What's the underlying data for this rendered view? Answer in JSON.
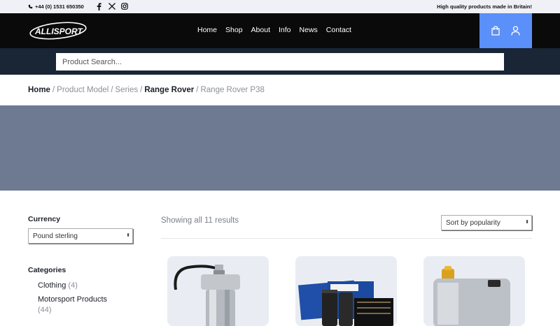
{
  "topbar": {
    "phone": "+44 (0) 1531 650350",
    "socials": [
      "facebook-icon",
      "x-icon",
      "instagram-icon"
    ],
    "tagline": "High quality products made in Britain!"
  },
  "header": {
    "logo_text": "ALLISPORT",
    "nav": [
      "Home",
      "Shop",
      "About",
      "Info",
      "News",
      "Contact"
    ],
    "accent": "#5b8ff9"
  },
  "search": {
    "placeholder": "Product Search..."
  },
  "breadcrumb": {
    "home": "Home",
    "product_model": "Product Model",
    "series": "Series",
    "range_rover": "Range Rover",
    "current": "Range Rover P38",
    "sep": "/"
  },
  "sidebar": {
    "currency_heading": "Currency",
    "currency_value": "Pound sterling",
    "categories_heading": "Categories",
    "categories": [
      {
        "label": "Clothing",
        "count": "(4)"
      },
      {
        "label": "Motorsport Products",
        "count": "(44)"
      }
    ]
  },
  "shop": {
    "results_text": "Showing all 11 results",
    "sort_value": "Sort by popularity"
  },
  "products": [
    {
      "name": "product-filter-hose"
    },
    {
      "name": "product-filter-kit"
    },
    {
      "name": "product-aluminium-tank"
    }
  ]
}
